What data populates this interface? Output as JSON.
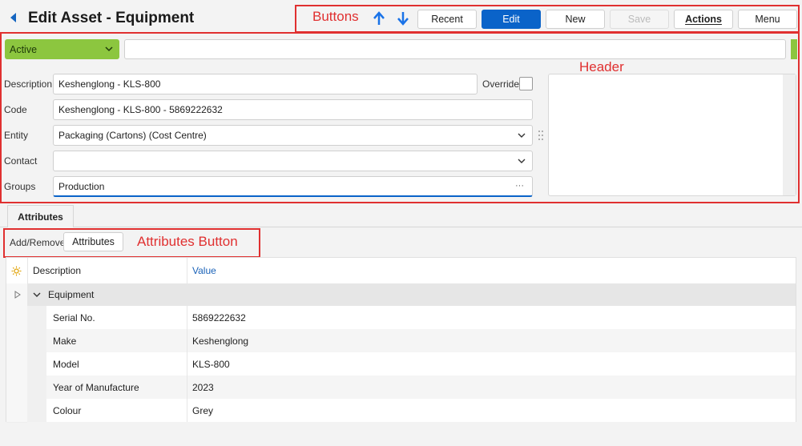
{
  "title": "Edit Asset - Equipment",
  "annotations": {
    "buttons": "Buttons",
    "header": "Header",
    "attributes_button": "Attributes Button"
  },
  "toolbar": {
    "recent": "Recent",
    "edit": "Edit",
    "new": "New",
    "save": "Save",
    "actions": "Actions",
    "menu": "Menu"
  },
  "status": {
    "value": "Active"
  },
  "fields": {
    "description": {
      "label": "Description",
      "value": "Keshenglong - KLS-800"
    },
    "override": {
      "label": "Override"
    },
    "code": {
      "label": "Code",
      "value": "Keshenglong - KLS-800 - 5869222632"
    },
    "entity": {
      "label": "Entity",
      "value": "Packaging (Cartons) (Cost Centre)"
    },
    "contact": {
      "label": "Contact",
      "value": ""
    },
    "groups": {
      "label": "Groups",
      "value": "Production",
      "more": "···"
    }
  },
  "tabs": {
    "attributes": "Attributes"
  },
  "attr_toolbar": {
    "add_remove": "Add/Remove",
    "attributes_btn": "Attributes"
  },
  "table": {
    "headers": {
      "description": "Description",
      "value": "Value"
    },
    "group": "Equipment",
    "rows": [
      {
        "description": "Serial No.",
        "value": "5869222632"
      },
      {
        "description": "Make",
        "value": "Keshenglong"
      },
      {
        "description": "Model",
        "value": "KLS-800"
      },
      {
        "description": "Year of Manufacture",
        "value": "2023"
      },
      {
        "description": "Colour",
        "value": "Grey"
      }
    ]
  },
  "colors": {
    "accent": "#0a63c9",
    "status_green": "#8cc63f",
    "annotation_red": "#e03030",
    "header_value_blue": "#1a62b8"
  }
}
